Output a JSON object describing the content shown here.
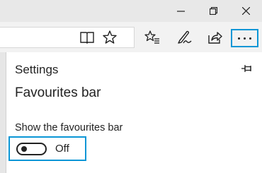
{
  "window_controls": {
    "minimize_icon": "minimize-icon",
    "restore_icon": "restore-icon",
    "close_icon": "close-icon"
  },
  "toolbar": {
    "icons": [
      "reading-view-icon",
      "favourite-star-icon",
      "favourites-hub-icon",
      "web-note-icon",
      "share-icon",
      "more-actions-icon"
    ],
    "highlight_color": "#0a96d6"
  },
  "settings_panel": {
    "title": "Settings",
    "pin_icon": "pin-icon",
    "section_title": "Favourites bar",
    "option_label": "Show the favourites bar",
    "toggle_state_label": "Off",
    "toggle_on": false
  }
}
